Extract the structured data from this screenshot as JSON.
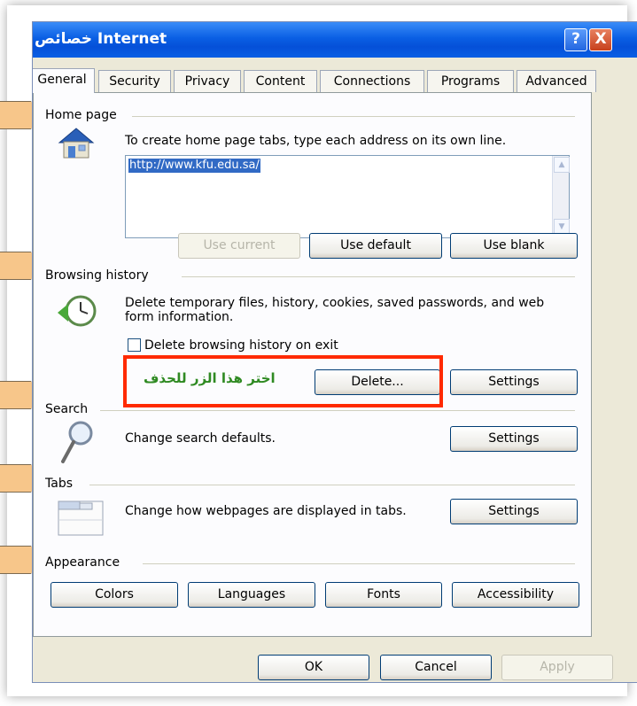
{
  "window": {
    "title": "خصائص Internet"
  },
  "title_buttons": {
    "help": "?",
    "close": "X"
  },
  "tabs": [
    "General",
    "Security",
    "Privacy",
    "Content",
    "Connections",
    "Programs",
    "Advanced"
  ],
  "home_page": {
    "heading": "Home page",
    "description": "To create home page tabs, type each address on its own line.",
    "url": "http://www.kfu.edu.sa/",
    "buttons": {
      "use_current": "Use current",
      "use_default": "Use default",
      "use_blank": "Use blank"
    }
  },
  "browsing_history": {
    "heading": "Browsing history",
    "description": "Delete temporary files, history, cookies, saved passwords, and web form information.",
    "checkbox_label": "Delete browsing history on exit",
    "checkbox_checked": false,
    "delete_button": "Delete...",
    "settings_button": "Settings"
  },
  "search": {
    "heading": "Search",
    "description": "Change search defaults.",
    "settings_button": "Settings"
  },
  "tabs_section": {
    "heading": "Tabs",
    "description": "Change how webpages are displayed in tabs.",
    "settings_button": "Settings"
  },
  "appearance": {
    "heading": "Appearance",
    "buttons": {
      "colors": "Colors",
      "languages": "Languages",
      "fonts": "Fonts",
      "accessibility": "Accessibility"
    }
  },
  "footer": {
    "ok": "OK",
    "cancel": "Cancel",
    "apply": "Apply"
  },
  "annotation": {
    "text": "اختر هذا الزر للحذف",
    "color": "#2f8a22",
    "box_color": "#ff2a00"
  },
  "colors": {
    "title_bar": "#0a5fe4",
    "dialog_bg": "#ece9d8",
    "callout_arrow": "#f7c68a"
  }
}
